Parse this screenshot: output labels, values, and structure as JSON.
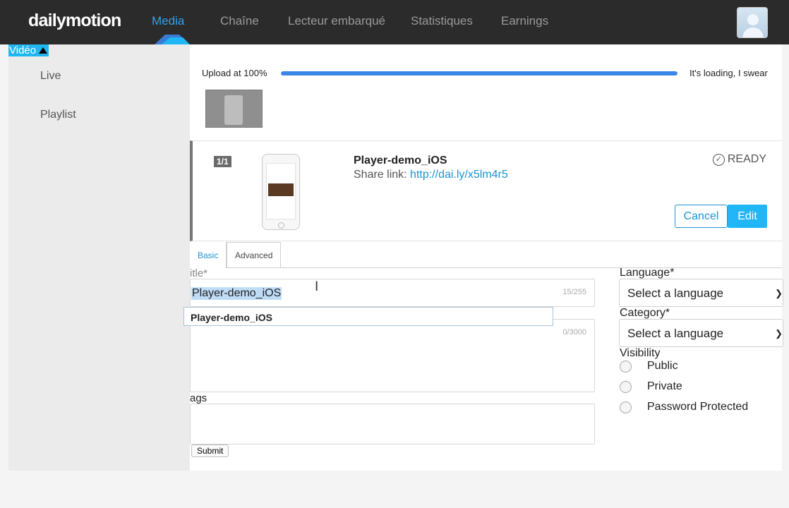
{
  "topbar": {
    "logo": "dailymotion",
    "nav": {
      "media": "Media",
      "chaine": "Chaîne",
      "lecteur": "Lecteur embarqué",
      "stats": "Statistiques",
      "earnings": "Earnings"
    },
    "active_color": "#2aa4f4"
  },
  "sidebar": {
    "video_toggle": "Vidéo",
    "items": [
      "Live",
      "Playlist"
    ]
  },
  "upload": {
    "label": "Upload at 100%",
    "progress_percent": 100,
    "note": "It's loading, I swear"
  },
  "video_card": {
    "counter": "1/1",
    "title": "Player-demo_iOS",
    "share_label": "Share link:",
    "share_url": "http://dai.ly/x5lm4r5",
    "status": "READY",
    "cancel_label": "Cancel",
    "edit_label": "Edit"
  },
  "tabs": {
    "basic": "Basic",
    "advanced": "Advanced"
  },
  "form": {
    "title_label": "itle*",
    "title_value": "Player-demo_iOS",
    "title_count": "15/255",
    "autocomplete": "Player-demo_iOS",
    "description_count": "0/3000",
    "tags_label": "ags",
    "submit_label": "Submit",
    "language_label": "Language*",
    "language_value": "Select a language",
    "category_label": "Category*",
    "category_value": "Select a language",
    "visibility_label": "Visibility",
    "visibility_options": [
      "Public",
      "Private",
      "Password Protected"
    ]
  }
}
